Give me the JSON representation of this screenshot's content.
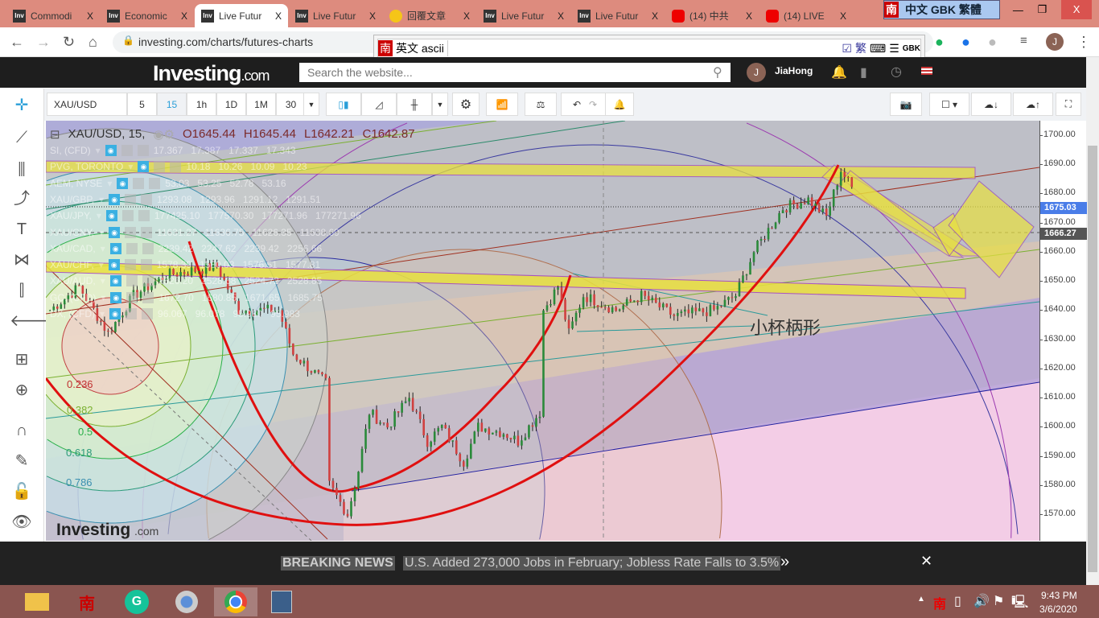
{
  "browser": {
    "tabs": [
      {
        "label": "Commodi",
        "icon": "investing-favicon"
      },
      {
        "label": "Economic",
        "icon": "investing-favicon"
      },
      {
        "label": "Live Futur",
        "icon": "investing-favicon",
        "active": true
      },
      {
        "label": "Live Futur",
        "icon": "investing-favicon"
      },
      {
        "label": "回覆文章",
        "icon": "bulb-favicon"
      },
      {
        "label": "Live Futur",
        "icon": "investing-favicon"
      },
      {
        "label": "Live Futur",
        "icon": "investing-favicon"
      },
      {
        "label": "(14) 中共",
        "icon": "youtube-favicon"
      },
      {
        "label": "(14) LIVE",
        "icon": "youtube-favicon"
      }
    ],
    "tab_close": "X",
    "url": "investing.com/charts/futures-charts",
    "avatar_letter": "J"
  },
  "ime": {
    "bar_label": "中文 GBK 繁體",
    "nan": "南",
    "input_mode": "英文 ascii",
    "trad": "繁",
    "gbk": "GBK"
  },
  "site": {
    "logo": "Investing",
    "logo_suffix": ".com",
    "search_placeholder": "Search the website...",
    "user": "JiaHong",
    "user_initial": "J"
  },
  "toolbar": {
    "symbol": "XAU/USD",
    "intervals": [
      "5",
      "15",
      "1h",
      "1D",
      "1M",
      "30"
    ],
    "active_interval": "15"
  },
  "legend": {
    "main": {
      "symbol": "XAU/USD, 15,",
      "open": "O1645.44",
      "high": "H1645.44",
      "low": "L1642.21",
      "close": "C1642.87"
    },
    "rows": [
      {
        "name": "SI, (CFD)",
        "values": "17.367   17.387   17.337   17.343"
      },
      {
        "name": "PVG, TORONTO",
        "values": "10.18   10.26   10.09   10.23"
      },
      {
        "name": "AEM, NYSE",
        "values": "53.03   53.25   52.78   53.16"
      },
      {
        "name": "XAU/GBP,",
        "values": "1293.08   1293.96   1291.12   1291.51"
      },
      {
        "name": "XAU/JPY,",
        "values": "177425.10   177570.30   177271.96   177271.96"
      },
      {
        "name": "XAU/CNY,",
        "values": "11631.27   11636.75   11626.35   11638.69"
      },
      {
        "name": "XAU/CAD,",
        "values": "2239.42   2247.62   2239.42   2256.66"
      },
      {
        "name": "XAU/CHF,",
        "values": "1578.39   1580.03   1576.51   1577.81"
      },
      {
        "name": "XAU/AUD,",
        "values": "2526.20   2528.68   2524.72   2528.85"
      },
      {
        "name": "GC, (CFD)",
        "values": "1672.70   1680.85   1671.65   1685.75"
      },
      {
        "name": "DX, (CFD)",
        "values": "96.067   96.078   95.980   95.983"
      }
    ]
  },
  "price_axis": {
    "ticks": [
      "1700.00",
      "1690.00",
      "1680.00",
      "1670.00",
      "1660.00",
      "1650.00",
      "1640.00",
      "1630.00",
      "1620.00",
      "1610.00",
      "1600.00",
      "1590.00",
      "1580.00",
      "1570.00"
    ],
    "last_price": "1675.03",
    "crosshair_price": "1666.27",
    "last_color": "#4a7de8"
  },
  "fib_levels": [
    "0.236",
    "0.382",
    "0.5",
    "0.618",
    "0.786"
  ],
  "annotation": "小杯柄形",
  "watermark": "Investing",
  "watermark_suffix": ".com",
  "price_anchors": [
    [
      0,
      1640
    ],
    [
      8,
      1648
    ],
    [
      16,
      1632
    ],
    [
      23,
      1645
    ],
    [
      32,
      1652
    ],
    [
      46,
      1655
    ],
    [
      52,
      1640
    ],
    [
      63,
      1640
    ],
    [
      67,
      1625
    ],
    [
      76,
      1615
    ],
    [
      77,
      1580
    ],
    [
      82,
      1570
    ],
    [
      85,
      1585
    ],
    [
      88,
      1605
    ],
    [
      93,
      1600
    ],
    [
      99,
      1610
    ],
    [
      104,
      1595
    ],
    [
      108,
      1600
    ],
    [
      114,
      1588
    ],
    [
      118,
      1600
    ],
    [
      125,
      1598
    ],
    [
      129,
      1595
    ],
    [
      135,
      1605
    ],
    [
      136,
      1640
    ],
    [
      140,
      1648
    ],
    [
      143,
      1632
    ],
    [
      147,
      1645
    ],
    [
      156,
      1640
    ],
    [
      163,
      1645
    ],
    [
      172,
      1638
    ],
    [
      183,
      1640
    ],
    [
      189,
      1645
    ],
    [
      194,
      1660
    ],
    [
      202,
      1675
    ],
    [
      209,
      1678
    ],
    [
      214,
      1672
    ],
    [
      218,
      1688
    ],
    [
      222,
      1680
    ]
  ],
  "news": {
    "label": "BREAKING NEWS",
    "headline": "U.S. Added 273,000 Jobs in February; Jobless Rate Falls to 3.5%",
    "more": "»",
    "close": "✕"
  },
  "taskbar": {
    "time": "9:43 PM",
    "date": "3/6/2020",
    "tray_ime": "南"
  }
}
